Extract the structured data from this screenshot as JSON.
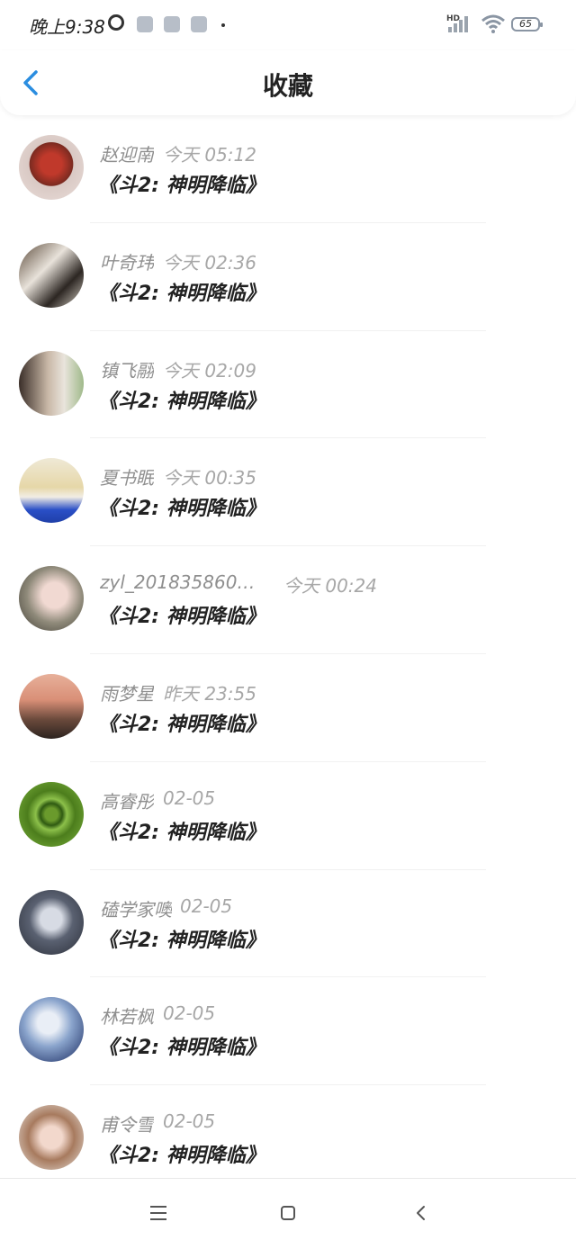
{
  "status_bar": {
    "time": "晚上9:38",
    "hd_label": "HD",
    "battery": "65"
  },
  "header": {
    "title": "收藏"
  },
  "colors": {
    "accent": "#2a8de0",
    "text_primary": "#222222",
    "text_secondary": "#8f8f8f"
  },
  "items": [
    {
      "name": "赵迎南",
      "time": "今天 05:12",
      "title": "《斗2: 神明降临》"
    },
    {
      "name": "叶奇玮",
      "time": "今天 02:36",
      "title": "《斗2: 神明降临》"
    },
    {
      "name": "镇飞翮",
      "time": "今天 02:09",
      "title": "《斗2: 神明降临》"
    },
    {
      "name": "夏书眠",
      "time": "今天 00:35",
      "title": "《斗2: 神明降临》"
    },
    {
      "name": "zyl_201835860…",
      "time": "今天 00:24",
      "title": "《斗2: 神明降临》"
    },
    {
      "name": "雨梦星",
      "time": "昨天 23:55",
      "title": "《斗2: 神明降临》"
    },
    {
      "name": "高睿彤",
      "time": "02-05",
      "title": "《斗2: 神明降临》"
    },
    {
      "name": "磕学家噢",
      "time": "02-05",
      "title": "《斗2: 神明降临》"
    },
    {
      "name": "林若枫",
      "time": "02-05",
      "title": "《斗2: 神明降临》"
    },
    {
      "name": "甫令雪",
      "time": "02-05",
      "title": "《斗2: 神明降临》"
    }
  ]
}
